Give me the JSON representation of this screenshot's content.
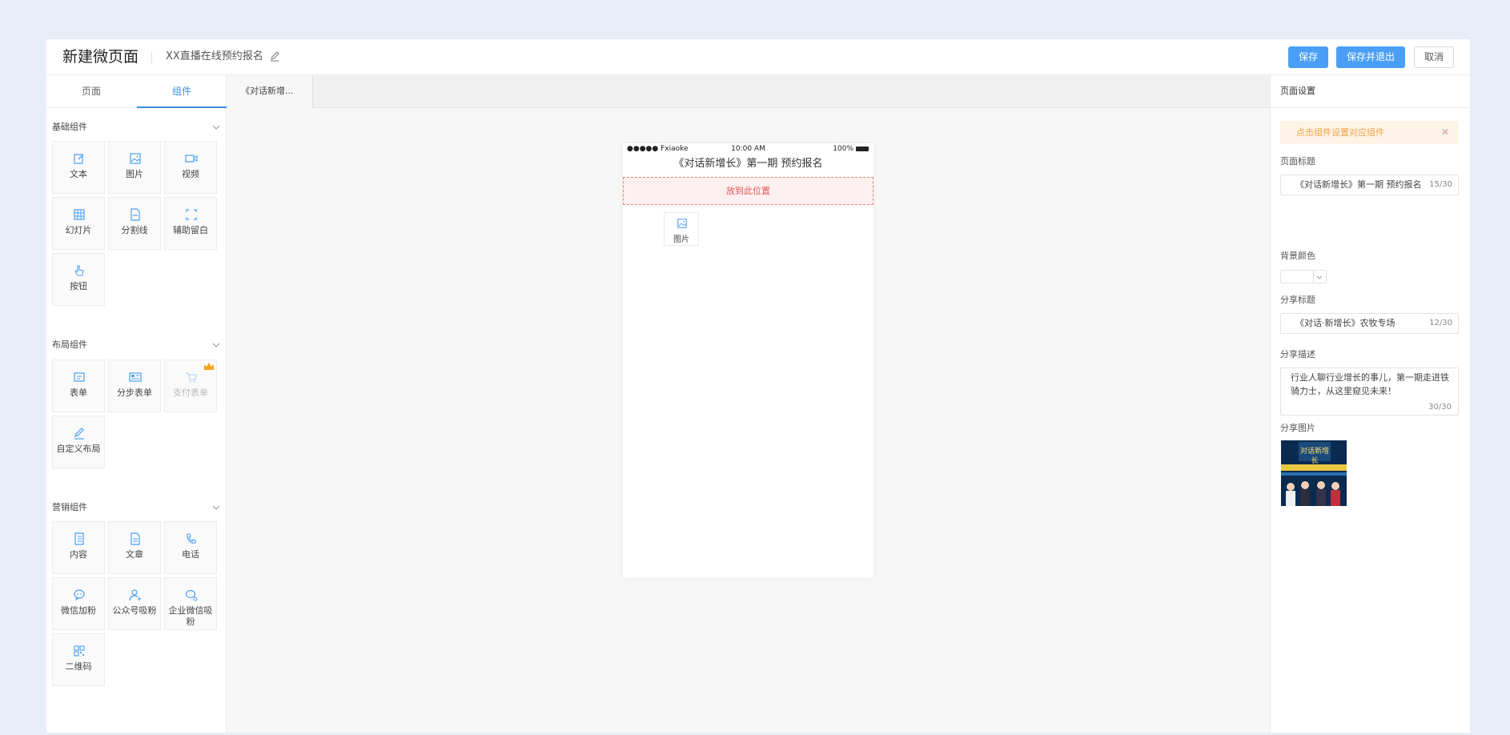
{
  "header": {
    "title": "新建微页面",
    "subtitle": "XX直播在线预约报名",
    "save_label": "保存",
    "save_exit_label": "保存并退出",
    "cancel_label": "取消"
  },
  "left_panel": {
    "tabs": [
      {
        "label": "页面",
        "active": false
      },
      {
        "label": "组件",
        "active": true
      }
    ],
    "groups": [
      {
        "title": "基础组件",
        "items": [
          {
            "label": "文本",
            "icon": "edit-icon"
          },
          {
            "label": "图片",
            "icon": "image-icon"
          },
          {
            "label": "视频",
            "icon": "video-icon"
          },
          {
            "label": "幻灯片",
            "icon": "slideshow-icon"
          },
          {
            "label": "分割线",
            "icon": "divider-icon"
          },
          {
            "label": "辅助留白",
            "icon": "whitespace-icon"
          },
          {
            "label": "按钮",
            "icon": "pointer-icon"
          }
        ]
      },
      {
        "title": "布局组件",
        "items": [
          {
            "label": "表单",
            "icon": "form-icon"
          },
          {
            "label": "分步表单",
            "icon": "step-form-icon"
          },
          {
            "label": "支付表单",
            "icon": "cart-icon",
            "disabled": true,
            "badge": "crown-icon"
          },
          {
            "label": "自定义布局",
            "icon": "pen-icon"
          }
        ]
      },
      {
        "title": "营销组件",
        "items": [
          {
            "label": "内容",
            "icon": "content-icon"
          },
          {
            "label": "文章",
            "icon": "article-icon"
          },
          {
            "label": "电话",
            "icon": "phone-icon"
          },
          {
            "label": "微信加粉",
            "icon": "wechat-icon"
          },
          {
            "label": "公众号吸粉",
            "icon": "user-add-icon"
          },
          {
            "label": "企业微信吸粉",
            "icon": "work-wechat-icon"
          },
          {
            "label": "二维码",
            "icon": "qrcode-icon"
          }
        ]
      }
    ]
  },
  "center": {
    "doc_tab": "《对话新增...",
    "status_bar": {
      "carrier": "●●●●● Fxiaoke",
      "time": "10:00 AM",
      "battery": "100%"
    },
    "phone_title": "《对话新增长》第一期 预约报名",
    "dropzone_label": "放到此位置",
    "drag_item_label": "图片"
  },
  "right_panel": {
    "heading": "页面设置",
    "tip": "点击组件设置对应组件",
    "page_title_label": "页面标题",
    "page_title_value": "《对话新增长》第一期 预约报名",
    "page_title_count": "15/30",
    "bg_color_label": "背景颜色",
    "share_title_label": "分享标题",
    "share_title_value": "《对话·新增长》农牧专场",
    "share_title_count": "12/30",
    "share_desc_label": "分享描述",
    "share_desc_value": "行业人聊行业增长的事儿，第一期走进铁骑力士，从这里窥见未来！",
    "share_desc_count": "30/30",
    "share_image_label": "分享图片",
    "share_image_text": "对话新增长"
  },
  "colors": {
    "primary": "#4a9ff5",
    "dropzone_border": "#f08080",
    "tip_text": "#f0a44b",
    "background": "#e7eef7"
  }
}
